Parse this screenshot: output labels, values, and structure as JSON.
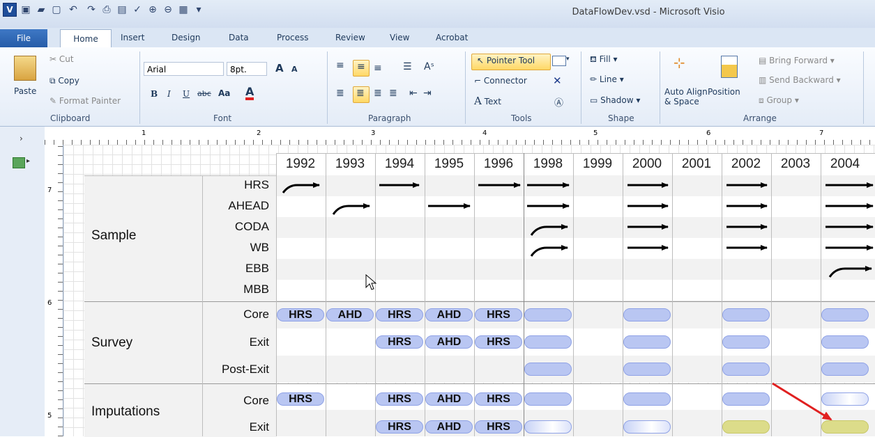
{
  "window": {
    "title": "DataFlowDev.vsd - Microsoft Visio"
  },
  "tabs": [
    "File",
    "Home",
    "Insert",
    "Design",
    "Data",
    "Process",
    "Review",
    "View",
    "Acrobat"
  ],
  "ribbon": {
    "clipboard": {
      "paste": "Paste",
      "cut": "Cut",
      "copy": "Copy",
      "format_painter": "Format Painter",
      "title": "Clipboard"
    },
    "font": {
      "family": "Arial",
      "size": "8pt.",
      "title": "Font",
      "grow": "A",
      "shrink": "A",
      "bold": "B",
      "italic": "I",
      "underline": "U",
      "strike": "abc",
      "case": "Aa",
      "color": "A"
    },
    "paragraph": {
      "title": "Paragraph"
    },
    "tools": {
      "pointer": "Pointer Tool",
      "connector": "Connector",
      "text": "Text",
      "title": "Tools"
    },
    "shape": {
      "fill": "Fill",
      "line": "Line",
      "shadow": "Shadow",
      "title": "Shape"
    },
    "arrange": {
      "auto_align": "Auto Align",
      "auto_align2": "& Space",
      "position": "Position",
      "bring_forward": "Bring Forward",
      "send_backward": "Send Backward",
      "group": "Group",
      "title": "Arrange"
    }
  },
  "ruler": {
    "h": [
      "1",
      "2",
      "3",
      "4",
      "5",
      "6",
      "7"
    ],
    "v": [
      "7",
      "6",
      "5"
    ]
  },
  "table": {
    "years": [
      "1992",
      "1993",
      "1994",
      "1995",
      "1996",
      "1998",
      "1999",
      "2000",
      "2001",
      "2002",
      "2003",
      "2004"
    ],
    "groups": {
      "sample": "Sample",
      "survey": "Survey",
      "imputations": "Imputations"
    },
    "rows": {
      "hrs": "HRS",
      "ahead": "AHEAD",
      "coda": "CODA",
      "wb": "WB",
      "ebb": "EBB",
      "mbb": "MBB",
      "core": "Core",
      "exit": "Exit",
      "post_exit": "Post-Exit",
      "icore": "Core",
      "iexit": "Exit"
    },
    "pill_labels": {
      "hrs": "HRS",
      "ahd": "AHD"
    }
  },
  "colors": {
    "pill": "#b9c6f2",
    "pill_yellow": "#dcdc8a",
    "arrow_red": "#e02020"
  }
}
